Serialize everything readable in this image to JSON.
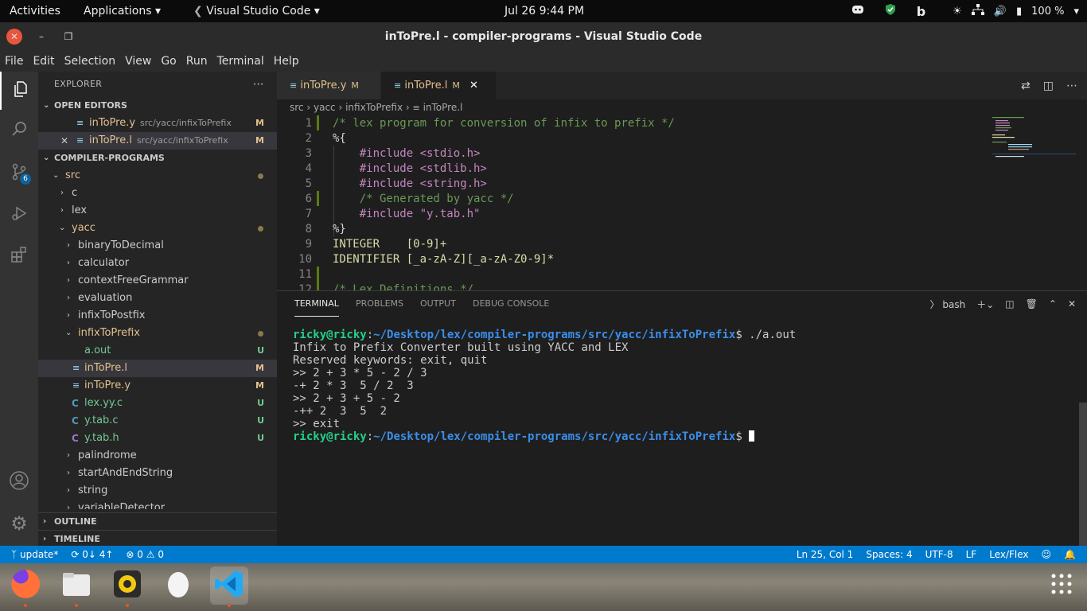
{
  "topbar": {
    "activities": "Activities",
    "applications": "Applications",
    "app_name": "Visual Studio Code",
    "datetime": "Jul 26   9:44 PM",
    "battery": "100 %"
  },
  "window": {
    "title": "inToPre.l - compiler-programs - Visual Studio Code"
  },
  "menu": [
    "File",
    "Edit",
    "Selection",
    "View",
    "Go",
    "Run",
    "Terminal",
    "Help"
  ],
  "activity": {
    "scm_badge": "6"
  },
  "sidebar": {
    "title": "EXPLORER",
    "open_editors_title": "OPEN EDITORS",
    "open_editors": [
      {
        "name": "inToPre.y",
        "path": "src/yacc/infixToPrefix",
        "status": "M"
      },
      {
        "name": "inToPre.l",
        "path": "src/yacc/infixToPrefix",
        "status": "M"
      }
    ],
    "project_title": "COMPILER-PROGRAMS",
    "tree": {
      "src": "src",
      "c": "c",
      "lex": "lex",
      "yacc": "yacc",
      "binaryToDecimal": "binaryToDecimal",
      "calculator": "calculator",
      "contextFreeGrammar": "contextFreeGrammar",
      "evaluation": "evaluation",
      "infixToPostfix": "infixToPostfix",
      "infixToPrefix": "infixToPrefix",
      "files": [
        {
          "name": "a.out",
          "status": "U"
        },
        {
          "name": "inToPre.l",
          "status": "M"
        },
        {
          "name": "inToPre.y",
          "status": "M"
        },
        {
          "name": "lex.yy.c",
          "status": "U"
        },
        {
          "name": "y.tab.c",
          "status": "U"
        },
        {
          "name": "y.tab.h",
          "status": "U"
        }
      ],
      "palindrome": "palindrome",
      "startAndEndString": "startAndEndString",
      "string": "string",
      "variableDetector": "variableDetector"
    },
    "outline": "OUTLINE",
    "timeline": "TIMELINE"
  },
  "tabs": [
    {
      "label": "inToPre.y",
      "status": "M"
    },
    {
      "label": "inToPre.l",
      "status": "M"
    }
  ],
  "breadcrumb": [
    "src",
    "yacc",
    "infixToPrefix",
    "inToPre.l"
  ],
  "code_lines": [
    {
      "n": "1",
      "text": "/* lex program for conversion of infix to prefix */"
    },
    {
      "n": "2",
      "text": "%{"
    },
    {
      "n": "3",
      "text": "    #include <stdio.h>"
    },
    {
      "n": "4",
      "text": "    #include <stdlib.h>"
    },
    {
      "n": "5",
      "text": "    #include <string.h>"
    },
    {
      "n": "6",
      "text": "    /* Generated by yacc */"
    },
    {
      "n": "7",
      "text": "    #include \"y.tab.h\""
    },
    {
      "n": "8",
      "text": "%}"
    },
    {
      "n": "9",
      "text": "INTEGER    [0-9]+"
    },
    {
      "n": "10",
      "text": "IDENTIFIER [_a-zA-Z][_a-zA-Z0-9]*"
    },
    {
      "n": "11",
      "text": ""
    },
    {
      "n": "12",
      "text": "/* Lex Definitions */"
    }
  ],
  "panel": {
    "tabs": [
      "TERMINAL",
      "PROBLEMS",
      "OUTPUT",
      "DEBUG CONSOLE"
    ],
    "shell": "bash",
    "prompt_user": "ricky@ricky",
    "prompt_path": "~/Desktop/lex/compiler-programs/src/yacc/infixToPrefix",
    "lines": [
      "$ ./a.out",
      "Infix to Prefix Converter built using YACC and LEX",
      "Reserved keywords: exit, quit",
      ">> 2 + 3 * 5 - 2 / 3",
      "-+ 2 * 3  5 / 2  3",
      ">> 2 + 3 + 5 - 2",
      "-++ 2  3  5  2",
      ">> exit",
      "$ "
    ]
  },
  "status": {
    "branch": "update*",
    "sync": "0↓ 4↑",
    "problems": "0",
    "warnings": "0",
    "position": "Ln 25, Col 1",
    "spaces": "Spaces: 4",
    "encoding": "UTF-8",
    "eol": "LF",
    "language": "Lex/Flex"
  },
  "colors": {
    "accent": "#007acc",
    "modified": "#e2c08d",
    "untracked": "#73c991",
    "prompt_user": "#23d18b",
    "prompt_path": "#3b8eea"
  }
}
